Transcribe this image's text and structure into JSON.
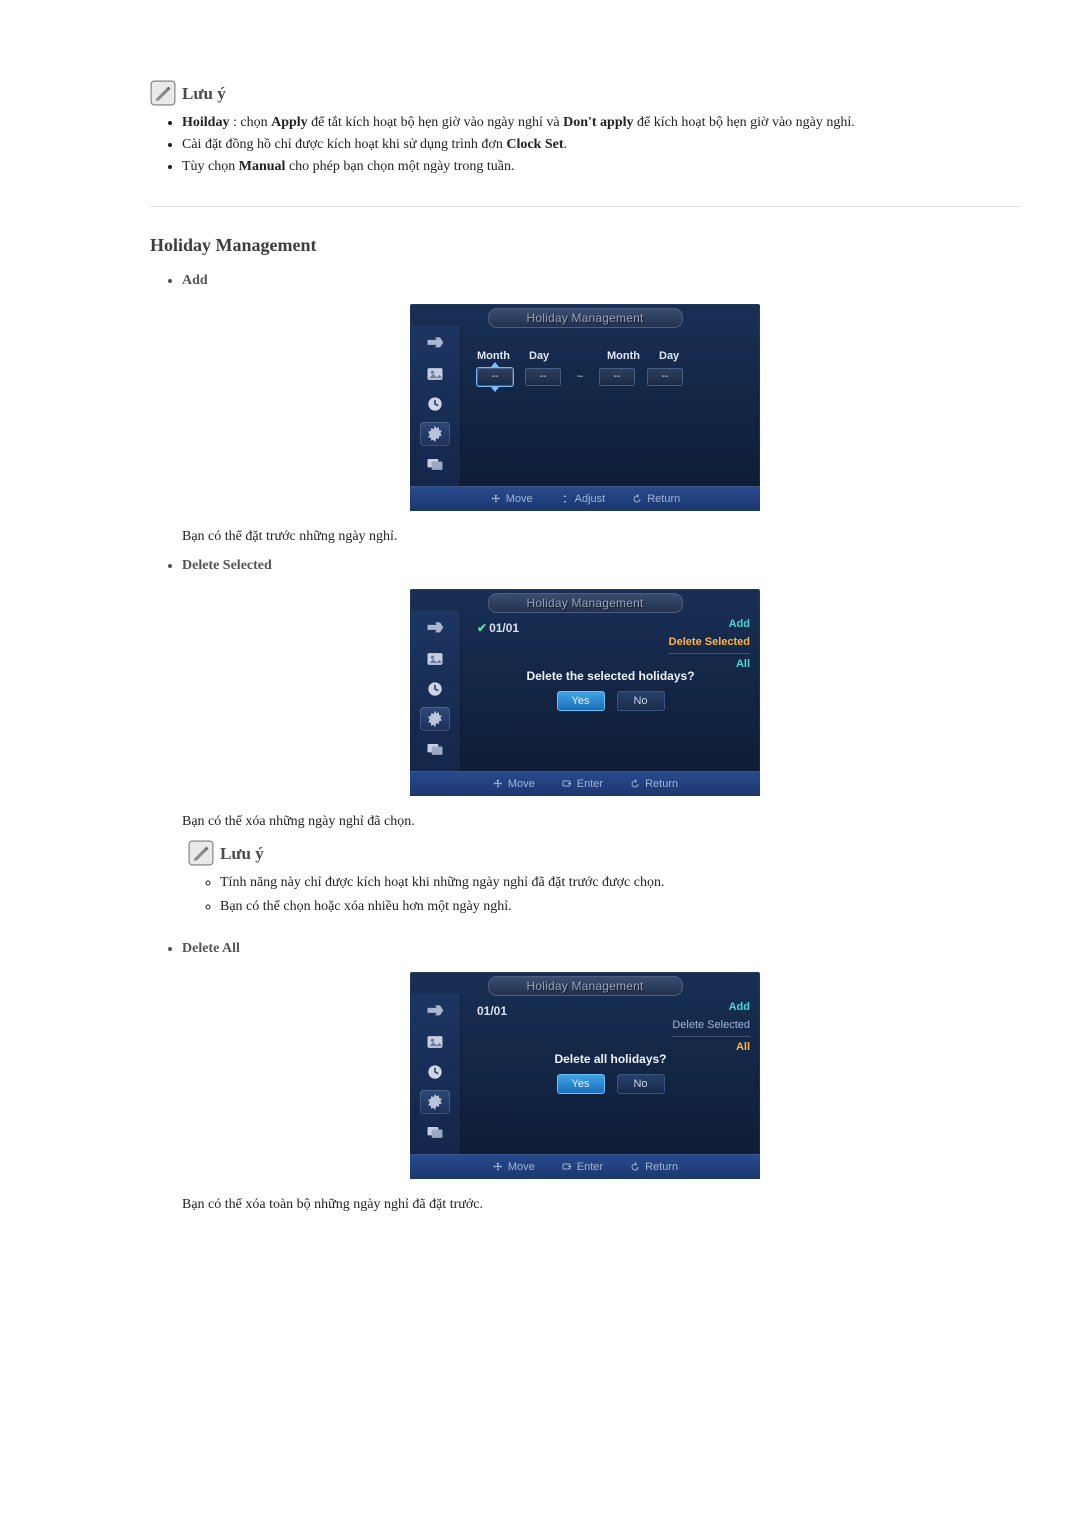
{
  "note1": {
    "title": "Lưu ý",
    "items": [
      {
        "pre": "Hoilday",
        "mid1": " : chọn ",
        "b1": "Apply",
        "mid2": " để tắt kích hoạt bộ hẹn giờ vào ngày nghỉ và ",
        "b2": "Don't apply",
        "post": " để kích hoạt bộ hẹn giờ vào ngày nghỉ."
      },
      {
        "pre": "Cài đặt đồng hồ chỉ được kích hoạt khi sử dụng trình đơn ",
        "b1": "Clock Set",
        "post": "."
      },
      {
        "pre": "Tùy chọn ",
        "b1": "Manual",
        "post": " cho phép bạn chọn một ngày trong tuần."
      }
    ]
  },
  "section": {
    "title": "Holiday Management"
  },
  "items": {
    "add": "Add",
    "delSel": "Delete Selected",
    "delAll": "Delete All"
  },
  "captions": {
    "add": "Bạn có thể đặt trước những ngày nghỉ.",
    "delSel": "Bạn có thể xóa những ngày nghỉ đã chọn.",
    "delAll": "Bạn có thể xóa toàn bộ những ngày nghỉ đã đặt trước."
  },
  "note2": {
    "title": "Lưu ý",
    "items": [
      "Tính năng này chỉ được kích hoạt khi những ngày nghỉ đã đặt trước được chọn.",
      "Bạn có thể chọn hoặc xóa nhiều hơn một ngày nghỉ."
    ]
  },
  "osd": {
    "title": "Holiday Management",
    "labels": {
      "month": "Month",
      "day": "Day",
      "tilde": "~"
    },
    "fieldVal": "--",
    "footer": {
      "move": "Move",
      "adjust": "Adjust",
      "enter": "Enter",
      "ret": "Return"
    },
    "menu": {
      "add": "Add",
      "delSel": "Delete Selected",
      "all": "All"
    },
    "date": "01/01",
    "dlgSel": "Delete the selected holidays?",
    "dlgAll": "Delete all holidays?",
    "yes": "Yes",
    "no": "No"
  }
}
